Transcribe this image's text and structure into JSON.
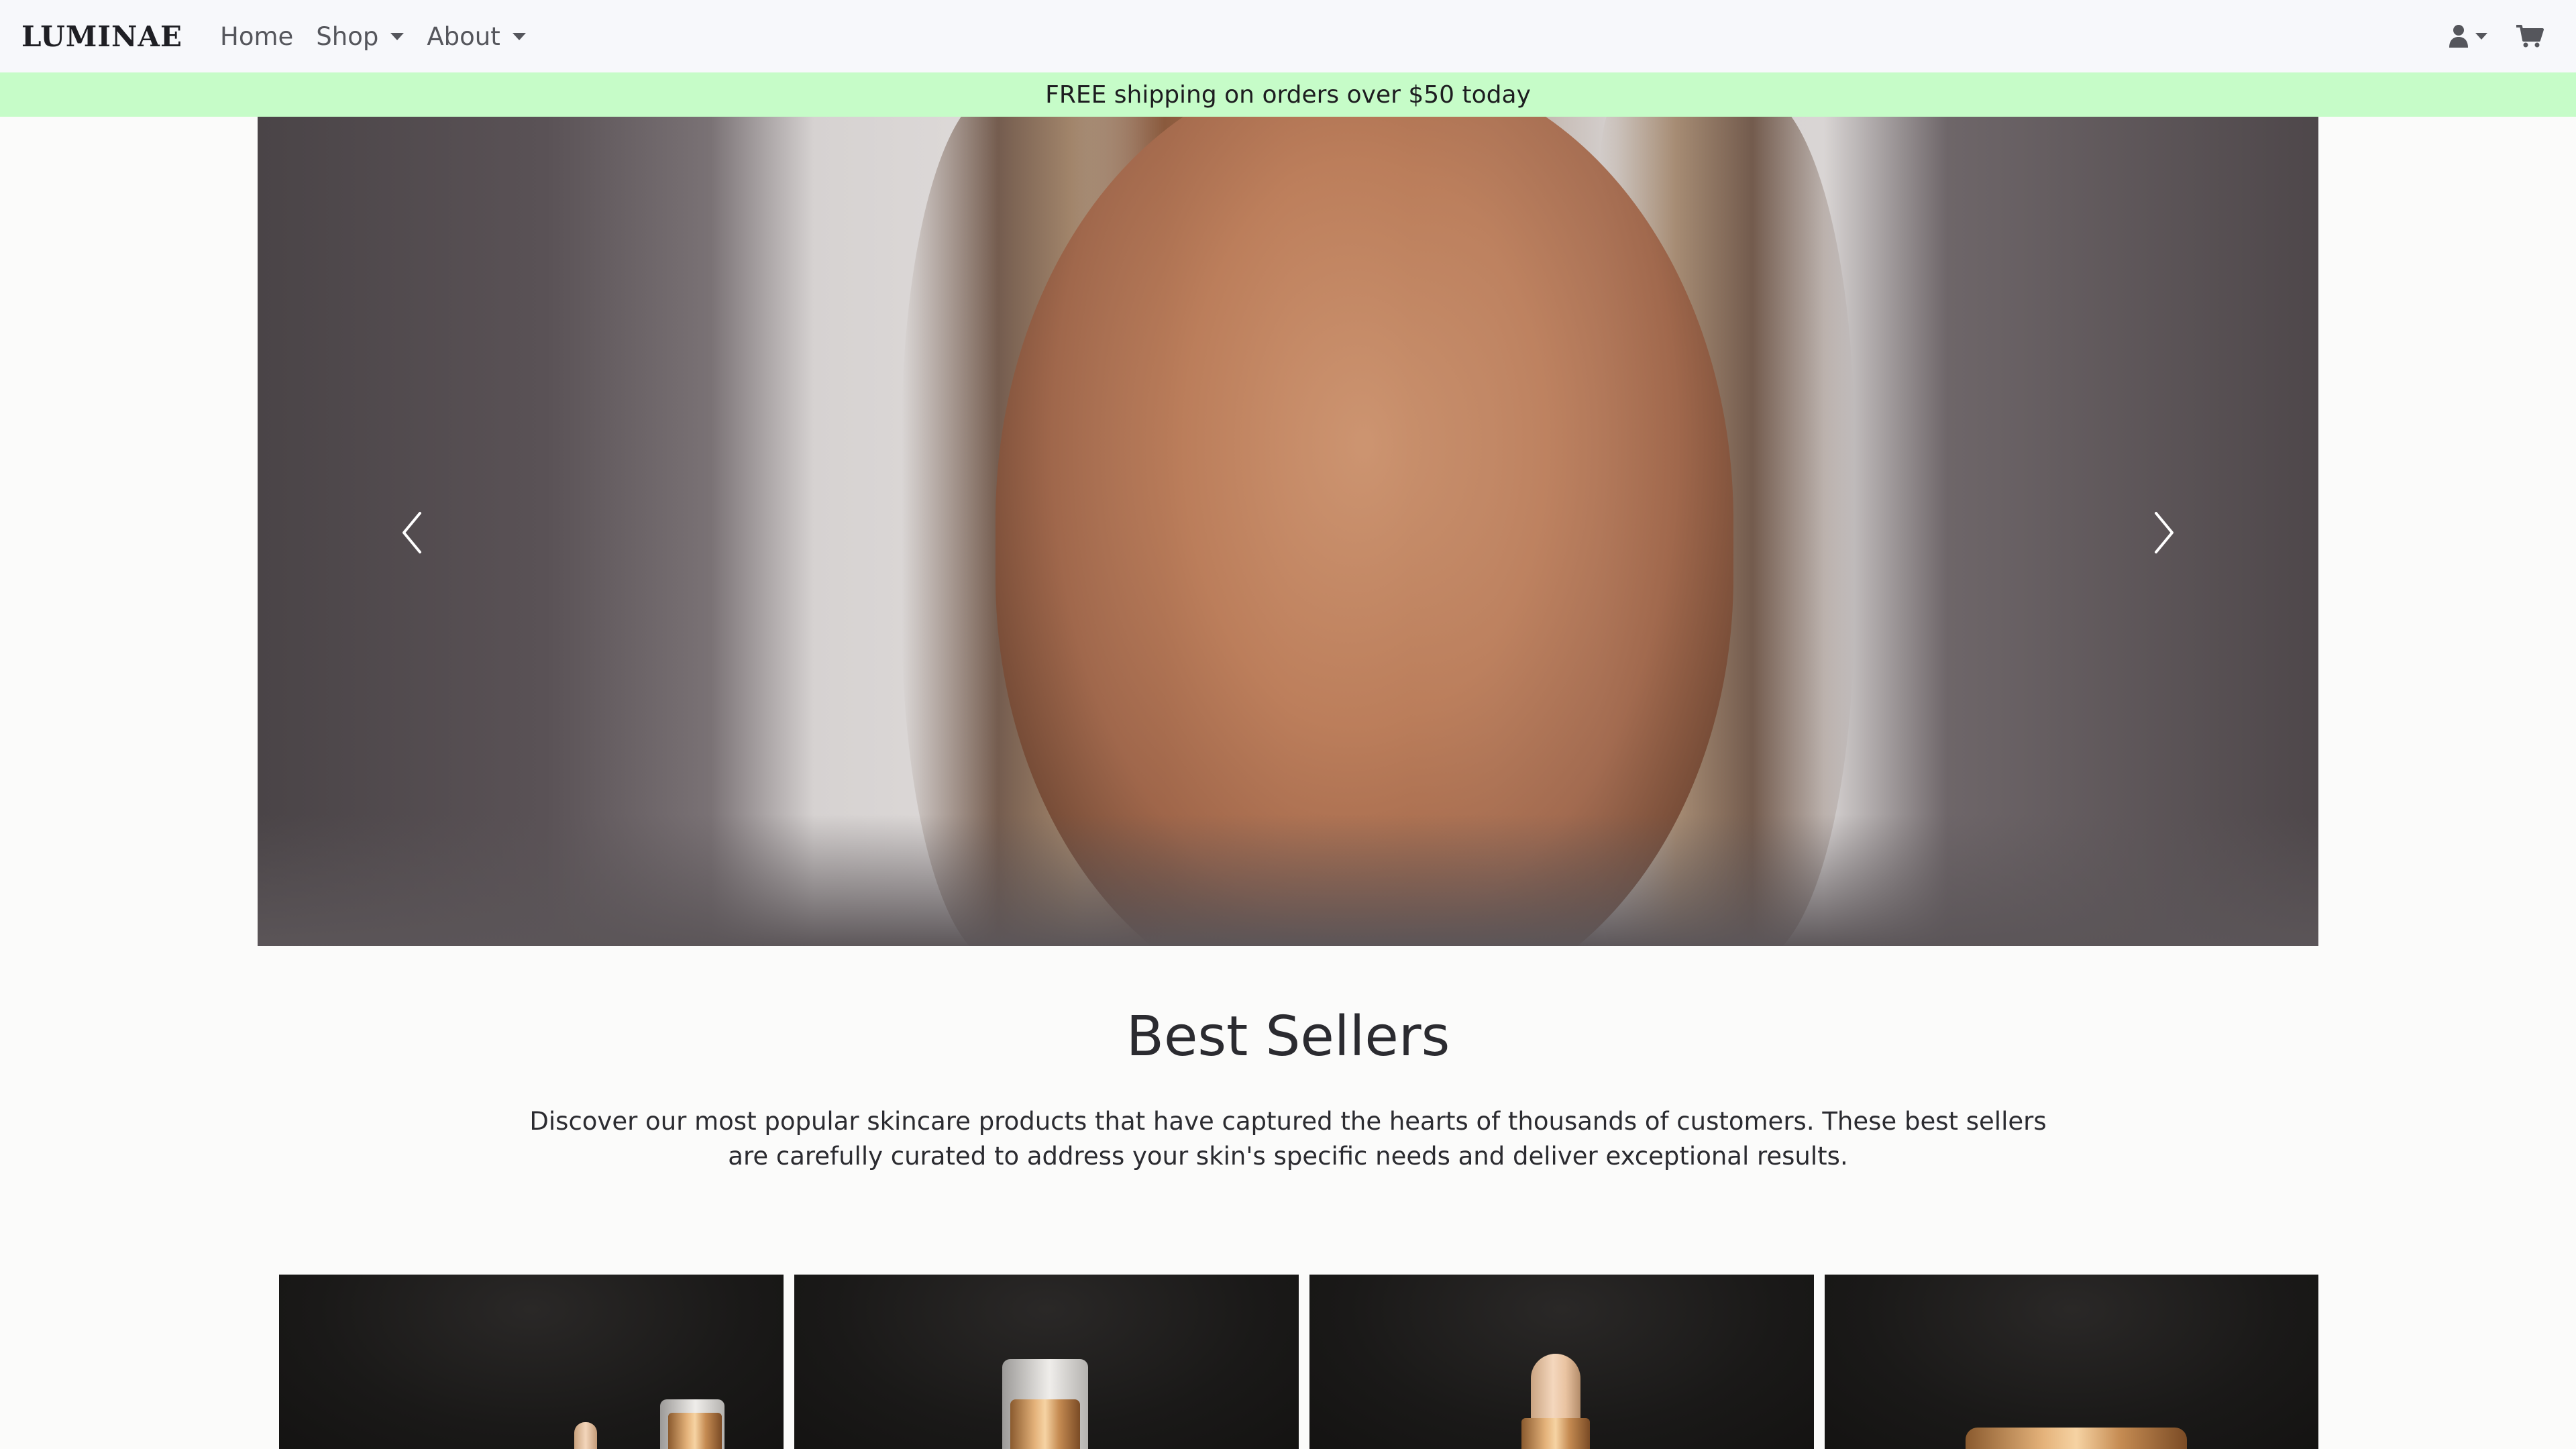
{
  "navbar": {
    "brand": "LUMINAE",
    "links": [
      {
        "label": "Home",
        "has_dropdown": false
      },
      {
        "label": "Shop",
        "has_dropdown": true
      },
      {
        "label": "About",
        "has_dropdown": true
      }
    ],
    "icons": [
      "user-icon",
      "cart-icon"
    ]
  },
  "promo": {
    "text": "FREE shipping on orders over $50 today",
    "background": "#c6fcc8"
  },
  "hero": {
    "controls": [
      "chevron-left-icon",
      "chevron-right-icon"
    ]
  },
  "best_sellers": {
    "title": "Best Sellers",
    "description": "Discover our most popular skincare products that have captured the hearts of thousands of customers. These best sellers are carefully curated to address your skin's specific needs and deliver exceptional results."
  },
  "colors": {
    "navbar_bg": "#f7f8fb",
    "page_bg": "#fbfbfa",
    "text": "#2b2b30",
    "product_bg": "#1a1918",
    "gold_accent": "#e4b27a"
  }
}
